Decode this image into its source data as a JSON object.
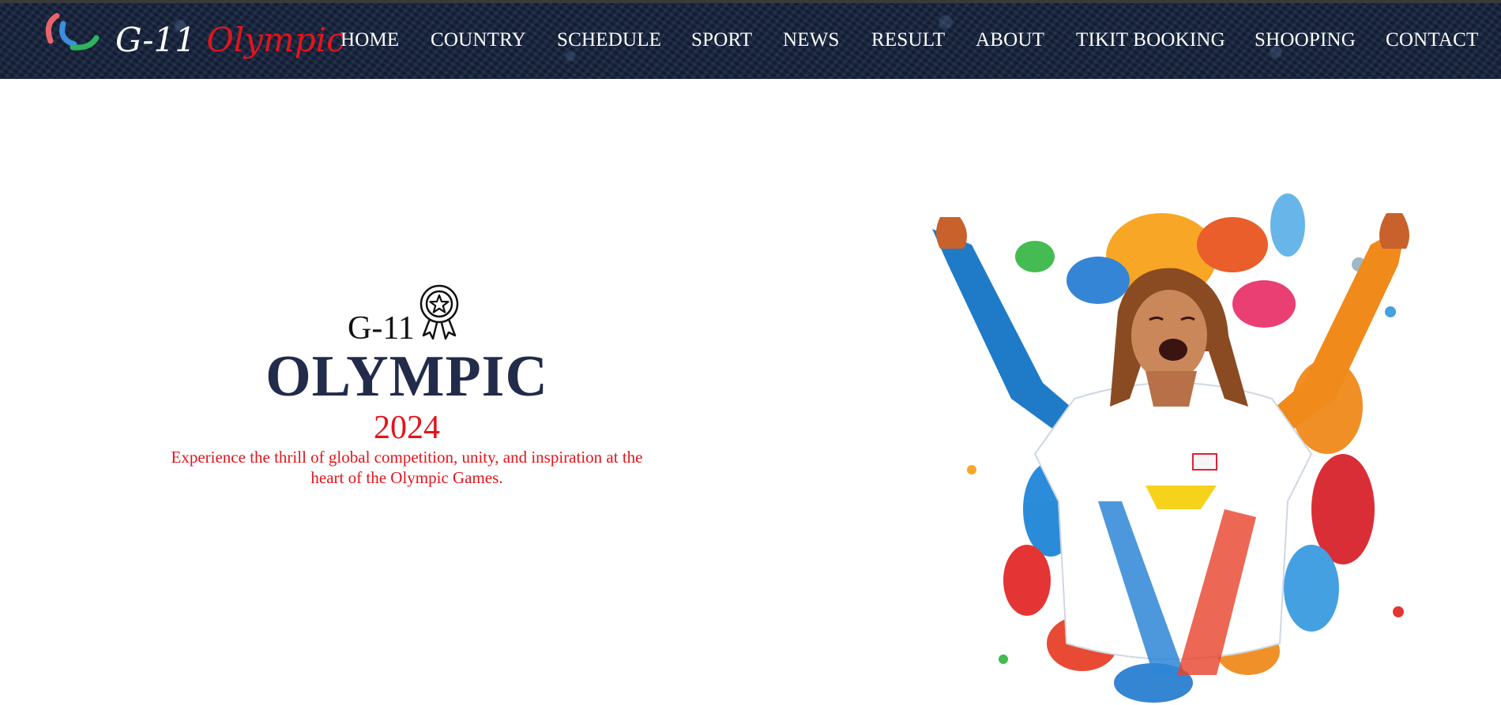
{
  "brand": {
    "logo_icon": "paralympic-agitos-icon",
    "logo_colors": [
      "#e8646c",
      "#3c8fdc",
      "#2fb35d"
    ],
    "name_prefix": "G-11",
    "name_suffix": "Olympic"
  },
  "nav": {
    "items": [
      {
        "label": "HOME"
      },
      {
        "label": "COUNTRY"
      },
      {
        "label": "SCHEDULE"
      },
      {
        "label": "SPORT"
      },
      {
        "label": "NEWS"
      },
      {
        "label": "RESULT"
      },
      {
        "label": "ABOUT"
      },
      {
        "label": "TIKIT BOOKING"
      },
      {
        "label": "SHOOPING"
      },
      {
        "label": "CONTACT"
      }
    ]
  },
  "hero": {
    "pre_title": "G-11",
    "badge_icon": "award-ribbon-icon",
    "title": "OLYMPIC",
    "year": "2024",
    "description": "Experience the thrill of global competition, unity, and inspiration at the heart of the Olympic Games.",
    "image_icon": "celebrating-athlete-paint-splash-illustration"
  },
  "colors": {
    "navbar_bg": "#15213a",
    "accent_red": "#e3141b",
    "title_navy": "#232b4b",
    "nav_text": "#ffffff"
  }
}
